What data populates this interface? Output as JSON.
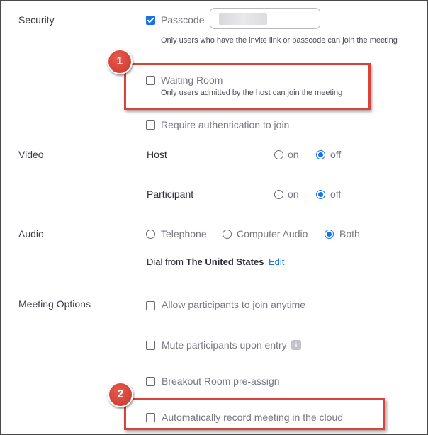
{
  "security": {
    "label": "Security",
    "passcode": {
      "label": "Passcode",
      "checked": true,
      "hint": "Only users who have the invite link or passcode can join the meeting"
    },
    "waiting_room": {
      "label": "Waiting Room",
      "checked": false,
      "hint": "Only users admitted by the host can join the meeting"
    },
    "require_auth": {
      "label": "Require authentication to join",
      "checked": false
    }
  },
  "video": {
    "label": "Video",
    "host": {
      "label": "Host",
      "on_label": "on",
      "off_label": "off",
      "selected": "off"
    },
    "participant": {
      "label": "Participant",
      "on_label": "on",
      "off_label": "off",
      "selected": "off"
    }
  },
  "audio": {
    "label": "Audio",
    "options": [
      "Telephone",
      "Computer Audio",
      "Both"
    ],
    "selected": "Both",
    "dial_from_prefix": "Dial from",
    "dial_from_country": "The United States",
    "edit_label": "Edit"
  },
  "meeting_options": {
    "label": "Meeting Options",
    "join_anytime": {
      "label": "Allow participants to join anytime",
      "checked": false
    },
    "mute_on_entry": {
      "label": "Mute participants upon entry",
      "checked": false
    },
    "breakout_preassign": {
      "label": "Breakout Room pre-assign",
      "checked": false
    },
    "auto_record_cloud": {
      "label": "Automatically record meeting in the cloud",
      "checked": false
    }
  },
  "annotations": {
    "badge_1": "1",
    "badge_2": "2"
  },
  "colors": {
    "accent": "#1673e6",
    "highlight": "#d9433a"
  }
}
